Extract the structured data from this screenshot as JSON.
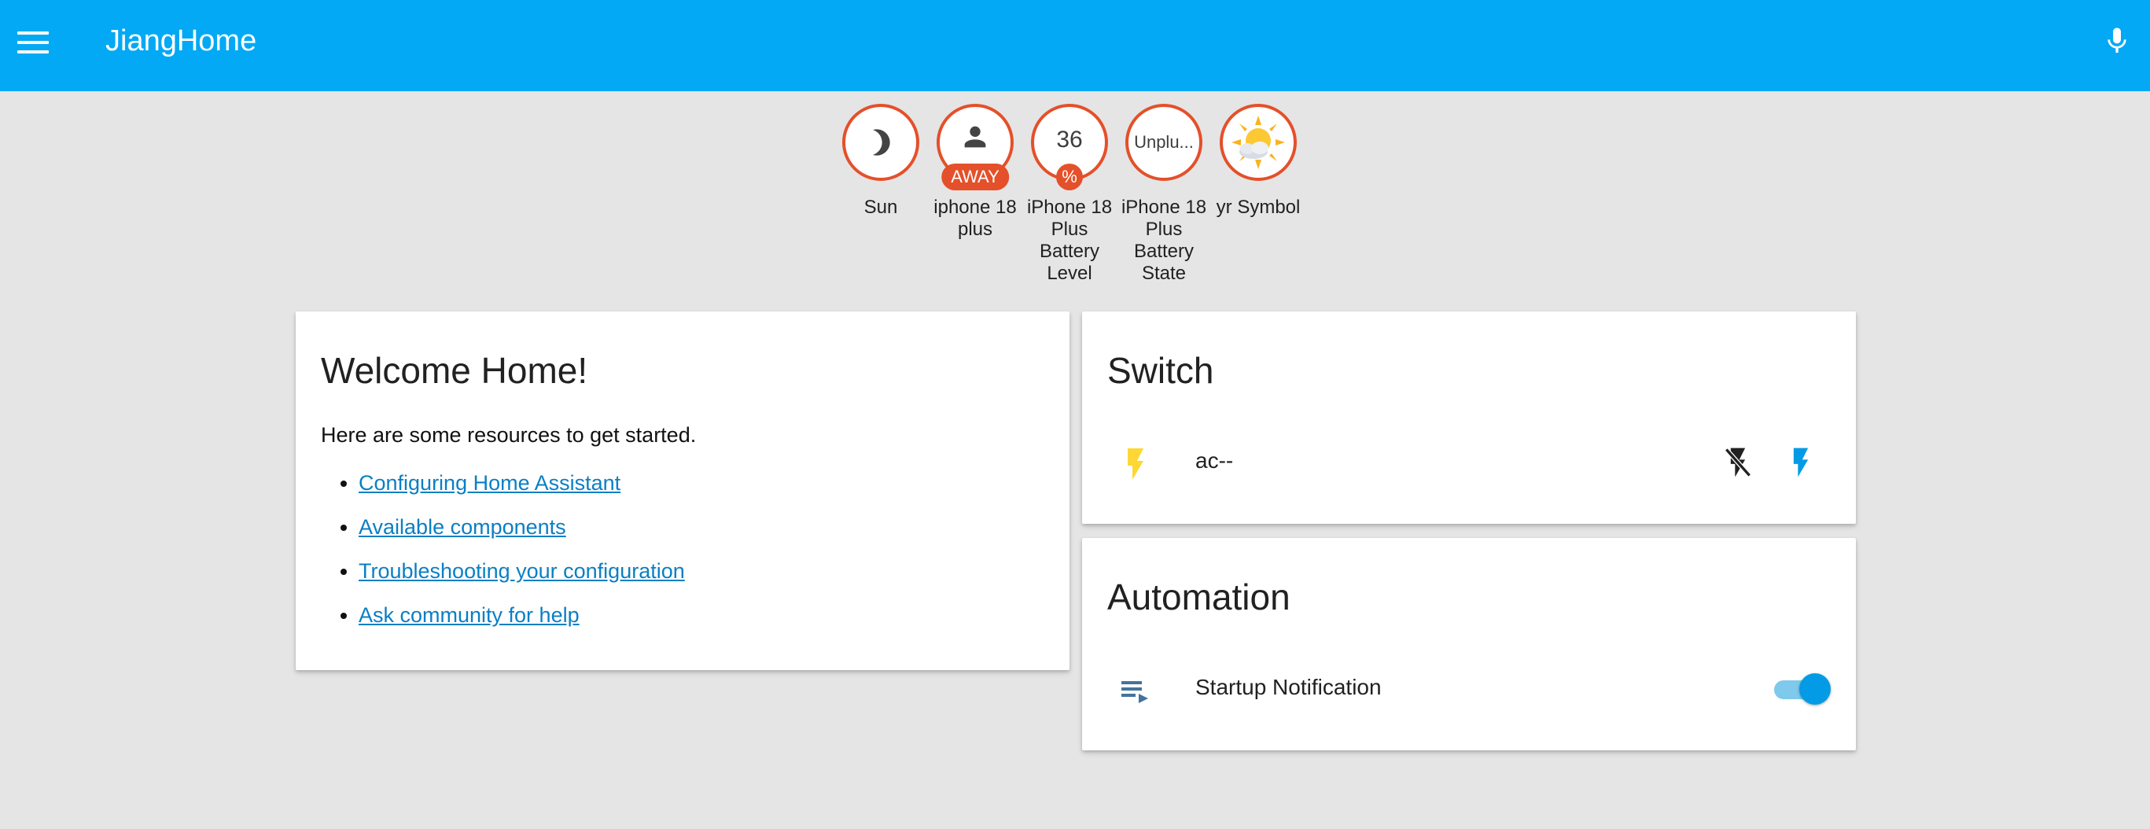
{
  "app": {
    "title": "JiangHome"
  },
  "badges": [
    {
      "label": "Sun",
      "value": "",
      "tag": "",
      "icon": "moon-icon"
    },
    {
      "label": "iphone 18 plus",
      "value": "",
      "tag": "AWAY",
      "icon": "person-icon"
    },
    {
      "label": "iPhone 18 Plus Battery Level",
      "value": "36",
      "tag": "%",
      "icon": ""
    },
    {
      "label": "iPhone 18 Plus Battery State",
      "value": "Unplu...",
      "tag": "",
      "icon": ""
    },
    {
      "label": "yr Symbol",
      "value": "",
      "tag": "",
      "icon": "partly-sunny-icon"
    }
  ],
  "welcome": {
    "title": "Welcome Home!",
    "text": "Here are some resources to get started.",
    "links": [
      "Configuring Home Assistant",
      "Available components",
      "Troubleshooting your configuration",
      "Ask community for help"
    ]
  },
  "switch_card": {
    "title": "Switch",
    "entity": {
      "name": "ac--",
      "icon": "flash-icon"
    }
  },
  "automation_card": {
    "title": "Automation",
    "entity": {
      "name": "Startup Notification",
      "icon": "playlist-play-icon",
      "state": "on"
    }
  },
  "colors": {
    "toolbar": "#03a9f4",
    "badge_accent": "#e4502a",
    "link": "#0a7fc4",
    "switch_on_icon": "#fdd835",
    "toggle_on": "#039be5"
  }
}
